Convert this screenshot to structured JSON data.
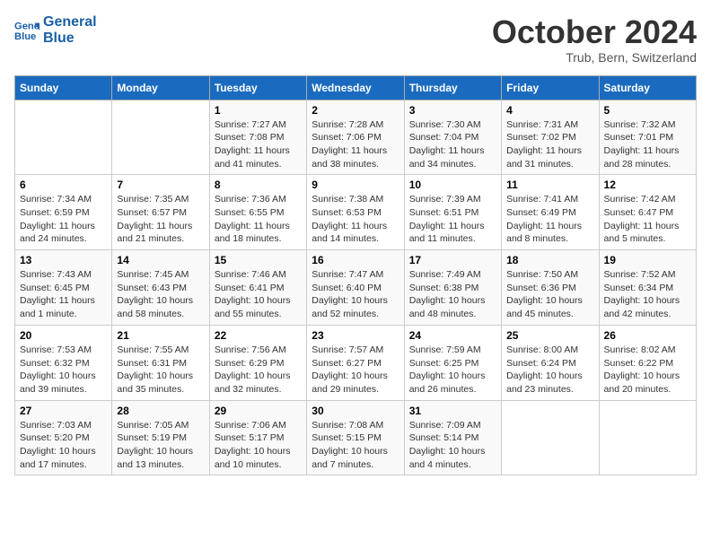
{
  "header": {
    "logo_line1": "General",
    "logo_line2": "Blue",
    "month": "October 2024",
    "location": "Trub, Bern, Switzerland"
  },
  "weekdays": [
    "Sunday",
    "Monday",
    "Tuesday",
    "Wednesday",
    "Thursday",
    "Friday",
    "Saturday"
  ],
  "weeks": [
    [
      {
        "day": "",
        "sunrise": "",
        "sunset": "",
        "daylight": ""
      },
      {
        "day": "",
        "sunrise": "",
        "sunset": "",
        "daylight": ""
      },
      {
        "day": "1",
        "sunrise": "Sunrise: 7:27 AM",
        "sunset": "Sunset: 7:08 PM",
        "daylight": "Daylight: 11 hours and 41 minutes."
      },
      {
        "day": "2",
        "sunrise": "Sunrise: 7:28 AM",
        "sunset": "Sunset: 7:06 PM",
        "daylight": "Daylight: 11 hours and 38 minutes."
      },
      {
        "day": "3",
        "sunrise": "Sunrise: 7:30 AM",
        "sunset": "Sunset: 7:04 PM",
        "daylight": "Daylight: 11 hours and 34 minutes."
      },
      {
        "day": "4",
        "sunrise": "Sunrise: 7:31 AM",
        "sunset": "Sunset: 7:02 PM",
        "daylight": "Daylight: 11 hours and 31 minutes."
      },
      {
        "day": "5",
        "sunrise": "Sunrise: 7:32 AM",
        "sunset": "Sunset: 7:01 PM",
        "daylight": "Daylight: 11 hours and 28 minutes."
      }
    ],
    [
      {
        "day": "6",
        "sunrise": "Sunrise: 7:34 AM",
        "sunset": "Sunset: 6:59 PM",
        "daylight": "Daylight: 11 hours and 24 minutes."
      },
      {
        "day": "7",
        "sunrise": "Sunrise: 7:35 AM",
        "sunset": "Sunset: 6:57 PM",
        "daylight": "Daylight: 11 hours and 21 minutes."
      },
      {
        "day": "8",
        "sunrise": "Sunrise: 7:36 AM",
        "sunset": "Sunset: 6:55 PM",
        "daylight": "Daylight: 11 hours and 18 minutes."
      },
      {
        "day": "9",
        "sunrise": "Sunrise: 7:38 AM",
        "sunset": "Sunset: 6:53 PM",
        "daylight": "Daylight: 11 hours and 14 minutes."
      },
      {
        "day": "10",
        "sunrise": "Sunrise: 7:39 AM",
        "sunset": "Sunset: 6:51 PM",
        "daylight": "Daylight: 11 hours and 11 minutes."
      },
      {
        "day": "11",
        "sunrise": "Sunrise: 7:41 AM",
        "sunset": "Sunset: 6:49 PM",
        "daylight": "Daylight: 11 hours and 8 minutes."
      },
      {
        "day": "12",
        "sunrise": "Sunrise: 7:42 AM",
        "sunset": "Sunset: 6:47 PM",
        "daylight": "Daylight: 11 hours and 5 minutes."
      }
    ],
    [
      {
        "day": "13",
        "sunrise": "Sunrise: 7:43 AM",
        "sunset": "Sunset: 6:45 PM",
        "daylight": "Daylight: 11 hours and 1 minute."
      },
      {
        "day": "14",
        "sunrise": "Sunrise: 7:45 AM",
        "sunset": "Sunset: 6:43 PM",
        "daylight": "Daylight: 10 hours and 58 minutes."
      },
      {
        "day": "15",
        "sunrise": "Sunrise: 7:46 AM",
        "sunset": "Sunset: 6:41 PM",
        "daylight": "Daylight: 10 hours and 55 minutes."
      },
      {
        "day": "16",
        "sunrise": "Sunrise: 7:47 AM",
        "sunset": "Sunset: 6:40 PM",
        "daylight": "Daylight: 10 hours and 52 minutes."
      },
      {
        "day": "17",
        "sunrise": "Sunrise: 7:49 AM",
        "sunset": "Sunset: 6:38 PM",
        "daylight": "Daylight: 10 hours and 48 minutes."
      },
      {
        "day": "18",
        "sunrise": "Sunrise: 7:50 AM",
        "sunset": "Sunset: 6:36 PM",
        "daylight": "Daylight: 10 hours and 45 minutes."
      },
      {
        "day": "19",
        "sunrise": "Sunrise: 7:52 AM",
        "sunset": "Sunset: 6:34 PM",
        "daylight": "Daylight: 10 hours and 42 minutes."
      }
    ],
    [
      {
        "day": "20",
        "sunrise": "Sunrise: 7:53 AM",
        "sunset": "Sunset: 6:32 PM",
        "daylight": "Daylight: 10 hours and 39 minutes."
      },
      {
        "day": "21",
        "sunrise": "Sunrise: 7:55 AM",
        "sunset": "Sunset: 6:31 PM",
        "daylight": "Daylight: 10 hours and 35 minutes."
      },
      {
        "day": "22",
        "sunrise": "Sunrise: 7:56 AM",
        "sunset": "Sunset: 6:29 PM",
        "daylight": "Daylight: 10 hours and 32 minutes."
      },
      {
        "day": "23",
        "sunrise": "Sunrise: 7:57 AM",
        "sunset": "Sunset: 6:27 PM",
        "daylight": "Daylight: 10 hours and 29 minutes."
      },
      {
        "day": "24",
        "sunrise": "Sunrise: 7:59 AM",
        "sunset": "Sunset: 6:25 PM",
        "daylight": "Daylight: 10 hours and 26 minutes."
      },
      {
        "day": "25",
        "sunrise": "Sunrise: 8:00 AM",
        "sunset": "Sunset: 6:24 PM",
        "daylight": "Daylight: 10 hours and 23 minutes."
      },
      {
        "day": "26",
        "sunrise": "Sunrise: 8:02 AM",
        "sunset": "Sunset: 6:22 PM",
        "daylight": "Daylight: 10 hours and 20 minutes."
      }
    ],
    [
      {
        "day": "27",
        "sunrise": "Sunrise: 7:03 AM",
        "sunset": "Sunset: 5:20 PM",
        "daylight": "Daylight: 10 hours and 17 minutes."
      },
      {
        "day": "28",
        "sunrise": "Sunrise: 7:05 AM",
        "sunset": "Sunset: 5:19 PM",
        "daylight": "Daylight: 10 hours and 13 minutes."
      },
      {
        "day": "29",
        "sunrise": "Sunrise: 7:06 AM",
        "sunset": "Sunset: 5:17 PM",
        "daylight": "Daylight: 10 hours and 10 minutes."
      },
      {
        "day": "30",
        "sunrise": "Sunrise: 7:08 AM",
        "sunset": "Sunset: 5:15 PM",
        "daylight": "Daylight: 10 hours and 7 minutes."
      },
      {
        "day": "31",
        "sunrise": "Sunrise: 7:09 AM",
        "sunset": "Sunset: 5:14 PM",
        "daylight": "Daylight: 10 hours and 4 minutes."
      },
      {
        "day": "",
        "sunrise": "",
        "sunset": "",
        "daylight": ""
      },
      {
        "day": "",
        "sunrise": "",
        "sunset": "",
        "daylight": ""
      }
    ]
  ]
}
